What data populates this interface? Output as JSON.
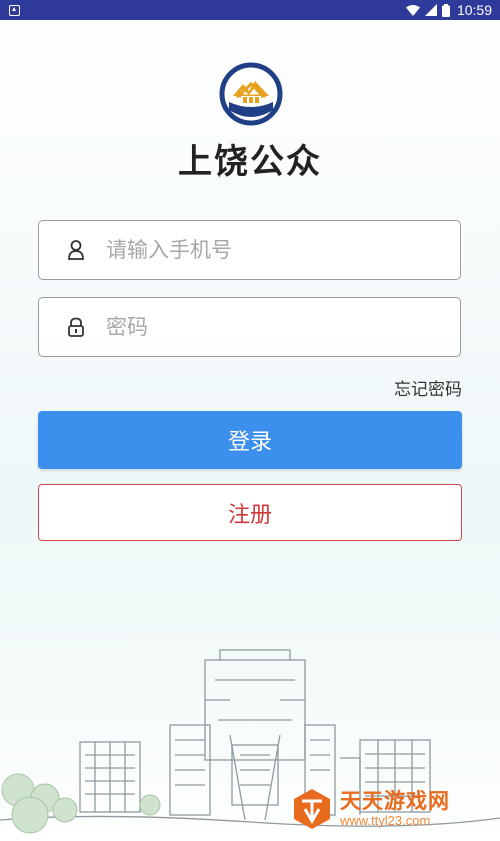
{
  "status_bar": {
    "time": "10:59",
    "icons": [
      "notification-icon",
      "wifi-icon",
      "cellular-icon",
      "battery-icon"
    ]
  },
  "app": {
    "title": "上饶公众",
    "logo": "house-emblem-logo"
  },
  "login_form": {
    "phone_placeholder": "请输入手机号",
    "phone_value": "",
    "password_placeholder": "密码",
    "password_value": "",
    "forgot_password": "忘记密码",
    "login_label": "登录",
    "register_label": "注册"
  },
  "watermark": {
    "name": "天天游戏网",
    "url": "www.ttyl23.com"
  },
  "colors": {
    "status_bar": "#2f3b9a",
    "primary": "#3d8fee",
    "register": "#cc3a3a",
    "watermark": "#e96c1e"
  }
}
